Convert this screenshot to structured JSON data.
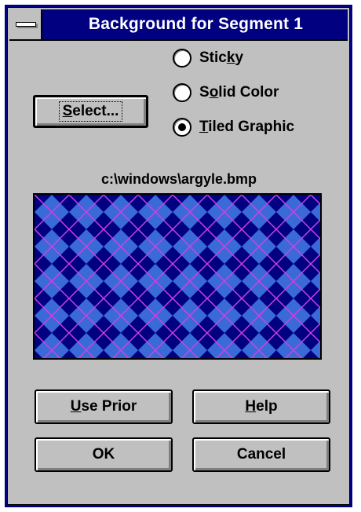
{
  "dialog": {
    "title": "Background for Segment 1"
  },
  "background_type": {
    "options": [
      {
        "pre": "Stic",
        "key": "k",
        "post": "y",
        "selected": false
      },
      {
        "pre": "S",
        "key": "o",
        "post": "lid Color",
        "selected": false
      },
      {
        "pre": "",
        "key": "T",
        "post": "iled Graphic",
        "selected": true
      }
    ]
  },
  "select_button": {
    "key": "S",
    "rest": "elect..."
  },
  "file": {
    "path": "c:\\windows\\argyle.bmp"
  },
  "buttons": {
    "use_prior": {
      "key": "U",
      "rest": "se Prior"
    },
    "help": {
      "key": "H",
      "rest": "elp"
    },
    "ok": "OK",
    "cancel": "Cancel"
  },
  "colors": {
    "titlebar": "#000080",
    "face": "#c0c0c0",
    "argyle_dark": "#000080",
    "argyle_light": "#3a6ad8",
    "argyle_lines": "#d040e0"
  },
  "icons": {
    "system_menu": "system-menu-icon"
  }
}
